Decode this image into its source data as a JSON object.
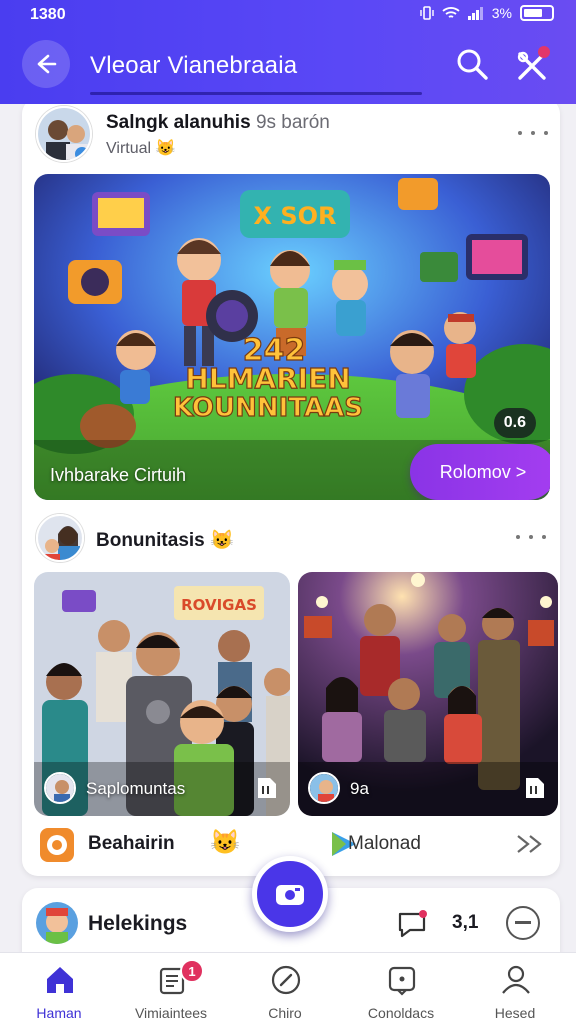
{
  "status": {
    "time": "1380",
    "battery_label": "3%"
  },
  "header": {
    "title": "Vleoar Vianebraaia"
  },
  "post1": {
    "author": "Salngk alanuhis",
    "author_suffix": "9s barón",
    "subtitle": "Virtual",
    "hero_caption": "Ivhbarake Cirtuih",
    "hero_counter": "0.6",
    "cta_label": "Rolomov >",
    "hero_banner_top": "X SOR",
    "hero_banner_year": "242",
    "hero_banner_line1": "HLMARIEN",
    "hero_banner_line2": "KOUNNITAAS"
  },
  "post2": {
    "author": "Bonunitasis",
    "thumb1_label": "Saplomuntas",
    "thumb1_sign": "ROVIGAS",
    "thumb2_label": "9a",
    "action1_label": "Beahairin",
    "action2_label": "Malonad"
  },
  "card2": {
    "title": "Helekings",
    "count": "3,1"
  },
  "nav": {
    "items": [
      {
        "label": "Haman",
        "icon": "home-icon"
      },
      {
        "label": "Vimiaintees",
        "icon": "notes-icon",
        "badge": "1"
      },
      {
        "label": "Chiro",
        "icon": "compass-icon"
      },
      {
        "label": "Conoldacs",
        "icon": "chat-square-icon"
      },
      {
        "label": "Hesed",
        "icon": "profile-icon"
      }
    ]
  },
  "colors": {
    "accent": "#4a3df0",
    "cta": "#9a38ec",
    "badge": "#e0315f"
  }
}
